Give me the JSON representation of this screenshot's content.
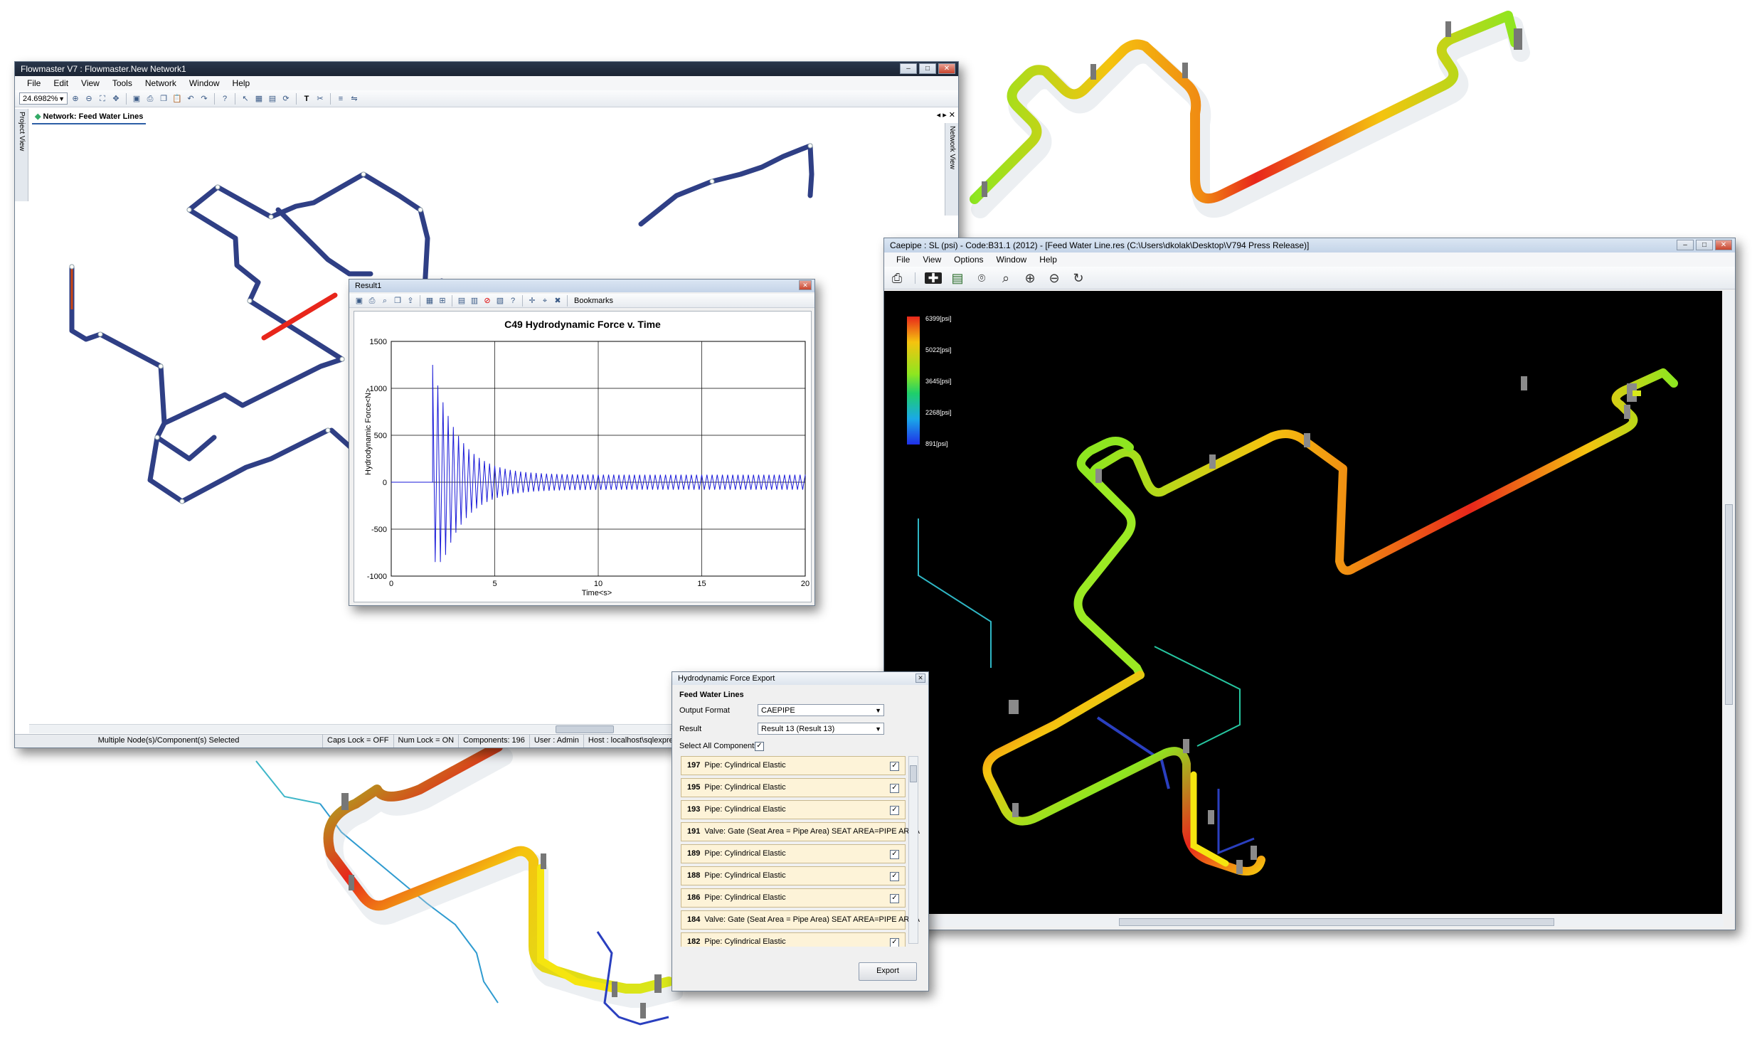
{
  "colors": {
    "hot": "#e8261b",
    "mid": "#f5c30f",
    "cool": "#8ee620",
    "pipe_blue": "#24357f",
    "signal": "#1a1ad8",
    "black_bg": "#000000"
  },
  "flowmaster": {
    "title": "Flowmaster V7 : Flowmaster.New Network1",
    "menu": [
      "File",
      "Edit",
      "View",
      "Tools",
      "Network",
      "Window",
      "Help"
    ],
    "zoom_value": "24.6982%",
    "side_tab": "Project View",
    "right_tab": "Network View",
    "network_tab_label": "Network: Feed Water Lines",
    "status": {
      "selection": "Multiple Node(s)/Component(s) Selected",
      "caps": "Caps Lock = OFF",
      "num": "Num Lock = ON",
      "components": "Components: 196",
      "user": "User : Admin",
      "host": "Host : localhost\\sqlexpress",
      "extra": "D"
    },
    "toolbar_icons": [
      "zoom-in-icon",
      "zoom-out-icon",
      "fit-icon",
      "save-icon",
      "print-icon",
      "copy-icon",
      "paste-icon",
      "undo-icon",
      "redo-icon",
      "help-icon",
      "pointer-icon",
      "grid-icon",
      "text-icon",
      "scissors-icon"
    ]
  },
  "result_window": {
    "title": "Result1",
    "bookmarks_label": "Bookmarks",
    "chart_title": "C49 Hydrodynamic Force v. Time",
    "ylabel": "Hydrodynamic Force<N>",
    "xlabel": "Time<s>",
    "close_glyph": "✕"
  },
  "chart_data": {
    "type": "line",
    "title": "C49 Hydrodynamic Force v. Time",
    "xlabel": "Time<s>",
    "ylabel": "Hydrodynamic Force<N>",
    "xlim": [
      0,
      20
    ],
    "ylim": [
      -1000,
      1500
    ],
    "xticks": [
      "0",
      "5",
      "10",
      "15",
      "20"
    ],
    "yticks": [
      "1500",
      "1000",
      "500",
      "0",
      "-500",
      "-1000"
    ],
    "grid": true,
    "series": [
      {
        "onset_time": 2.0,
        "pre_onset_value": 0,
        "peak_max": 1250,
        "peak_min": -850,
        "decay_time": 1.2,
        "steady_amplitude": 80,
        "oscillation_period": 0.25,
        "end_time": 20
      }
    ]
  },
  "caepipe": {
    "title": "Caepipe : SL (psi) - Code:B31.1 (2012) - [Feed Water Line.res (C:\\Users\\dkolak\\Desktop\\V794 Press Release)]",
    "menu": [
      "File",
      "View",
      "Options",
      "Window",
      "Help"
    ],
    "toolbar_icons": [
      "print-icon",
      "crosshair-icon",
      "notes-icon",
      "camera-icon",
      "zoom-icon",
      "zoom-in-icon",
      "zoom-out-icon",
      "rotate-icon"
    ],
    "legend": {
      "labels": [
        "6399[psi]",
        "5022[psi]",
        "3645[psi]",
        "2268[psi]",
        "891[psi]"
      ]
    }
  },
  "export_dialog": {
    "title": "Hydrodynamic Force Export",
    "group_label": "Feed Water Lines",
    "output_format_label": "Output Format",
    "output_format_value": "CAEPIPE",
    "result_label": "Result",
    "result_value": "Result 13 (Result 13)",
    "select_all_label": "Select All Components",
    "items": [
      {
        "id": "197",
        "desc": "Pipe: Cylindrical Elastic"
      },
      {
        "id": "195",
        "desc": "Pipe: Cylindrical Elastic"
      },
      {
        "id": "193",
        "desc": "Pipe: Cylindrical Elastic"
      },
      {
        "id": "191",
        "desc": "Valve: Gate (Seat Area = Pipe Area)  SEAT AREA=PIPE AREA"
      },
      {
        "id": "189",
        "desc": "Pipe: Cylindrical Elastic"
      },
      {
        "id": "188",
        "desc": "Pipe: Cylindrical Elastic"
      },
      {
        "id": "186",
        "desc": "Pipe: Cylindrical Elastic"
      },
      {
        "id": "184",
        "desc": "Valve: Gate (Seat Area = Pipe Area)  SEAT AREA=PIPE AREA"
      },
      {
        "id": "182",
        "desc": "Pipe: Cylindrical Elastic"
      }
    ],
    "export_label": "Export"
  }
}
